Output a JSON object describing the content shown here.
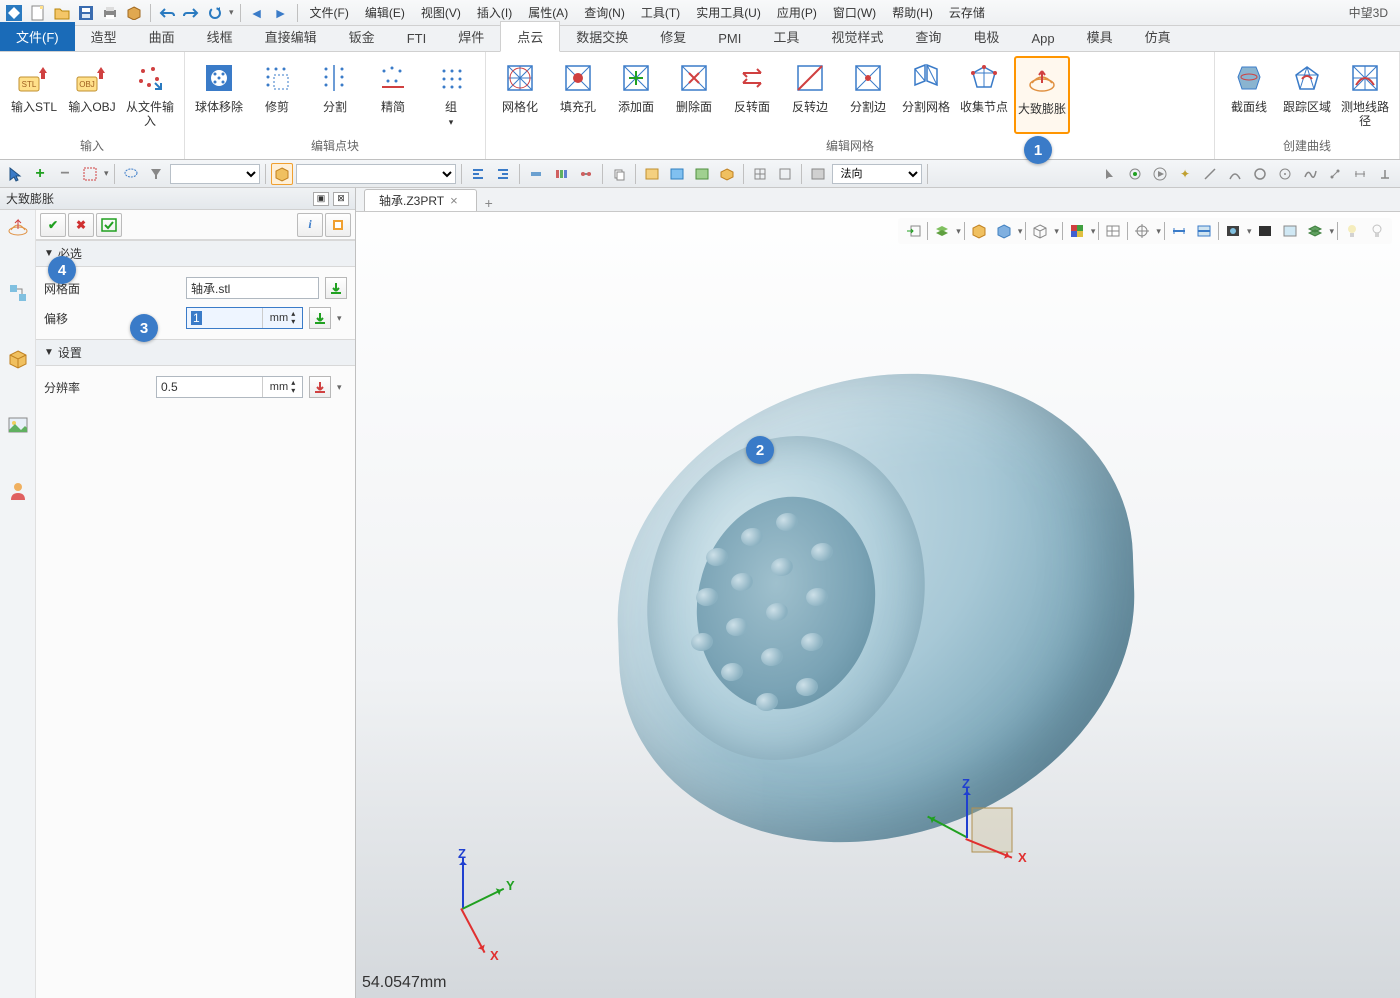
{
  "brand": "中望3D",
  "menus": [
    "文件(F)",
    "编辑(E)",
    "视图(V)",
    "插入(I)",
    "属性(A)",
    "查询(N)",
    "工具(T)",
    "实用工具(U)",
    "应用(P)",
    "窗口(W)",
    "帮助(H)",
    "云存储"
  ],
  "ribbon_tabs": [
    "文件(F)",
    "造型",
    "曲面",
    "线框",
    "直接编辑",
    "钣金",
    "FTI",
    "焊件",
    "点云",
    "数据交换",
    "修复",
    "PMI",
    "工具",
    "视觉样式",
    "查询",
    "电极",
    "App",
    "模具",
    "仿真"
  ],
  "active_ribbon_tab_index": 0,
  "selected_ribbon_tab_index": 8,
  "ribbon_groups": [
    {
      "label": "输入",
      "buttons": [
        "输入STL",
        "输入OBJ",
        "从文件输入"
      ]
    },
    {
      "label": "编辑点块",
      "buttons": [
        "球体移除",
        "修剪",
        "分割",
        "精简",
        "组"
      ]
    },
    {
      "label": "编辑网格",
      "buttons": [
        "网格化",
        "填充孔",
        "添加面",
        "删除面",
        "反转面",
        "反转边",
        "分割边",
        "分割网格",
        "收集节点",
        "大致膨胀"
      ]
    },
    {
      "label": "创建曲线",
      "buttons": [
        "截面线",
        "跟踪区域",
        "测地线路径"
      ]
    }
  ],
  "highlighted_ribbon_button": "大致膨胀",
  "sec_combo_value": "法向",
  "panel_title": "大致膨胀",
  "section_required": "必选",
  "section_settings": "设置",
  "fields": {
    "mesh_face": {
      "label": "网格面",
      "value": "轴承.stl"
    },
    "offset": {
      "label": "偏移",
      "value": "1",
      "unit": "mm"
    },
    "resolution": {
      "label": "分辨率",
      "value": "0.5",
      "unit": "mm"
    }
  },
  "doc_tab": "轴承.Z3PRT",
  "status_text": "54.0547mm",
  "axis_labels": {
    "x": "X",
    "y": "Y",
    "z": "Z"
  },
  "callouts": {
    "c1": "1",
    "c2": "2",
    "c3": "3",
    "c4": "4"
  }
}
